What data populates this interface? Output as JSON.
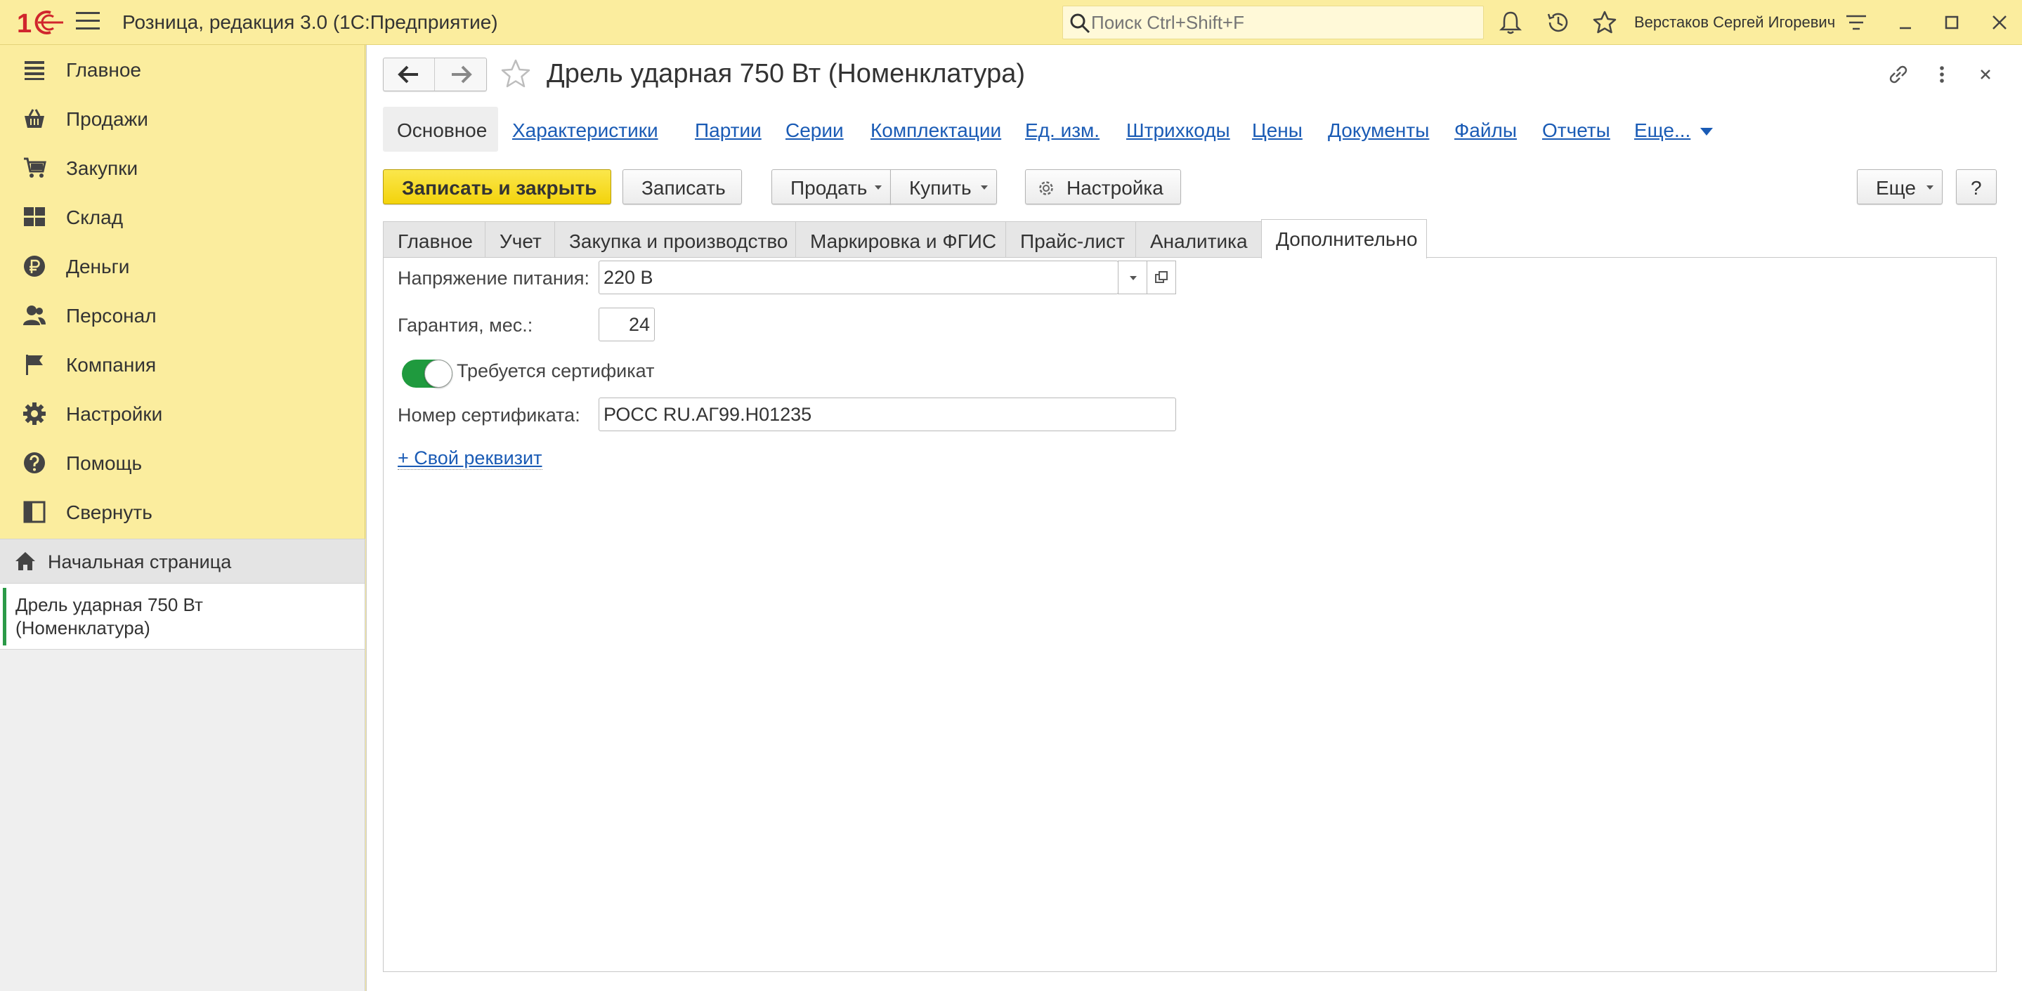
{
  "app": {
    "title": "Розница, редакция 3.0  (1С:Предприятие)",
    "search_placeholder": "Поиск Ctrl+Shift+F",
    "user": "Верстаков Сергей Игоревич"
  },
  "sidebar": {
    "sections": [
      {
        "label": "Главное",
        "icon": "hamburger-lines-icon"
      },
      {
        "label": "Продажи",
        "icon": "basket-icon"
      },
      {
        "label": "Закупки",
        "icon": "cart-icon"
      },
      {
        "label": "Склад",
        "icon": "warehouse-grid-icon"
      },
      {
        "label": "Деньги",
        "icon": "ruble-coin-icon"
      },
      {
        "label": "Персонал",
        "icon": "people-icon"
      },
      {
        "label": "Компания",
        "icon": "flag-icon"
      },
      {
        "label": "Настройки",
        "icon": "gear-icon"
      },
      {
        "label": "Помощь",
        "icon": "question-circle-icon"
      },
      {
        "label": "Свернуть",
        "icon": "collapse-panel-icon"
      }
    ],
    "home": "Начальная страница",
    "open_window": "Дрель ударная 750 Вт (Номенклатура)"
  },
  "form": {
    "title": "Дрель ударная 750 Вт (Номенклатура)",
    "panel_current": "Основное",
    "panel_links": [
      "Характеристики",
      "Партии",
      "Серии",
      "Комплектации",
      "Ед. изм.",
      "Штрихкоды",
      "Цены",
      "Документы",
      "Файлы",
      "Отчеты",
      "Еще..."
    ],
    "commands": {
      "save_close": "Записать и закрыть",
      "save": "Записать",
      "sell": "Продать",
      "buy": "Купить",
      "settings": "Настройка",
      "more": "Еще",
      "help": "?"
    },
    "tabs": [
      "Главное",
      "Учет",
      "Закупка и производство",
      "Маркировка и ФГИС",
      "Прайс-лист",
      "Аналитика",
      "Дополнительно"
    ],
    "active_tab": "Дополнительно",
    "fields": {
      "voltage_label": "Напряжение питания:",
      "voltage_value": "220 В",
      "warranty_label": "Гарантия, мес.:",
      "warranty_value": "24",
      "cert_required_label": "Требуется сертификат",
      "cert_required": true,
      "cert_number_label": "Номер сертификата:",
      "cert_number_value": "РОСС RU.АГ99.Н01235",
      "add_attribute": "+ Свой реквизит"
    }
  },
  "colors": {
    "theme_yellow": "#fbed9e",
    "primary_button": "#f5d90f",
    "link": "#1a5bb5",
    "toggle_on": "#1f9a3e",
    "logo_red": "#d0262d"
  }
}
